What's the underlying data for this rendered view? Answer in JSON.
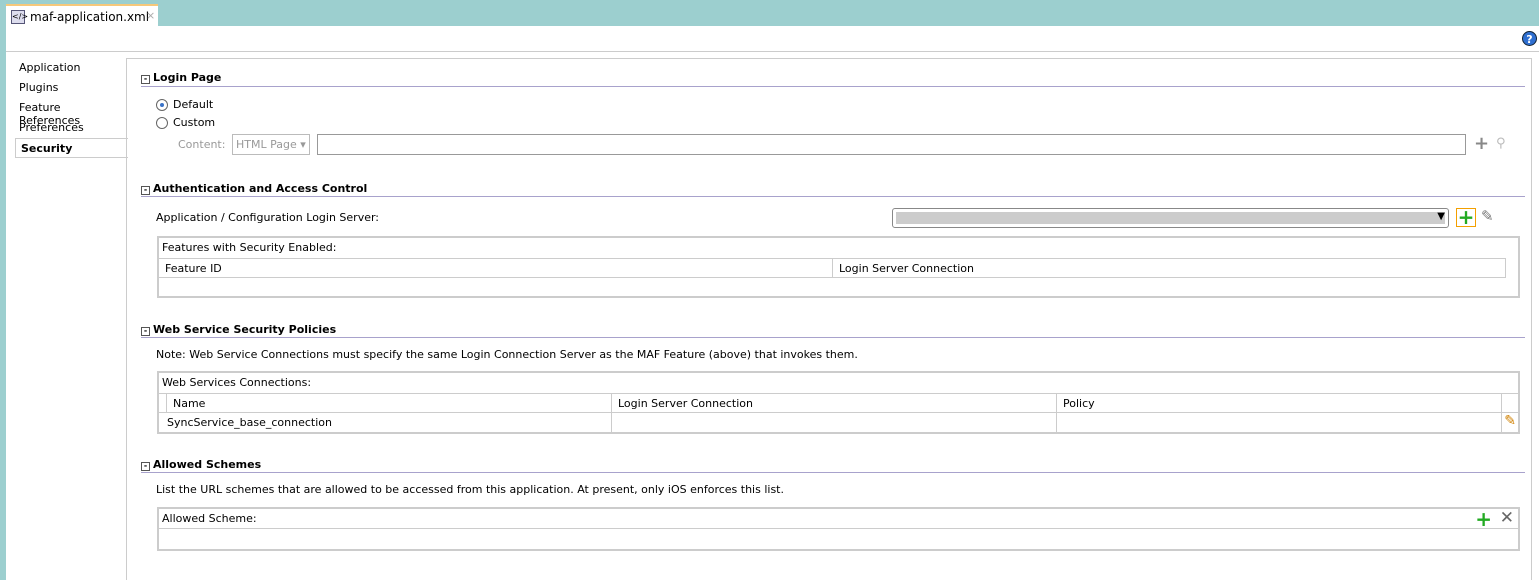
{
  "tab": {
    "title": "maf-application.xml",
    "close": "×",
    "icon": "xml-file-icon"
  },
  "help": "?",
  "nav": [
    "Application",
    "Plugins",
    "Feature References",
    "Preferences",
    "Security"
  ],
  "login": {
    "title": "Login Page",
    "default": "Default",
    "custom": "Custom",
    "content_label": "Content:",
    "content_type": "HTML Page",
    "content_value": ""
  },
  "auth": {
    "title": "Authentication and Access Control",
    "server_label": "Application / Configuration Login Server:",
    "server_value": "",
    "table_title": "Features with Security Enabled:",
    "columns": [
      "Feature ID",
      "Login Server Connection"
    ]
  },
  "ws": {
    "title": "Web Service Security Policies",
    "note": "Note: Web Service Connections must specify the same Login Connection Server as the MAF Feature (above) that invokes them.",
    "table_title": "Web Services Connections:",
    "columns": [
      "Name",
      "Login Server Connection",
      "Policy"
    ],
    "rows": [
      [
        "SyncService_base_connection",
        "",
        ""
      ]
    ]
  },
  "schemes": {
    "title": "Allowed Schemes",
    "desc": "List the URL schemes that are allowed to be accessed from this application.  At present, only iOS enforces this list.",
    "table_title": "Allowed Scheme:"
  },
  "colors": {
    "tabbar": "#9ccfcf",
    "add_green": "#22aa22",
    "rule": "#a8a2cc"
  }
}
